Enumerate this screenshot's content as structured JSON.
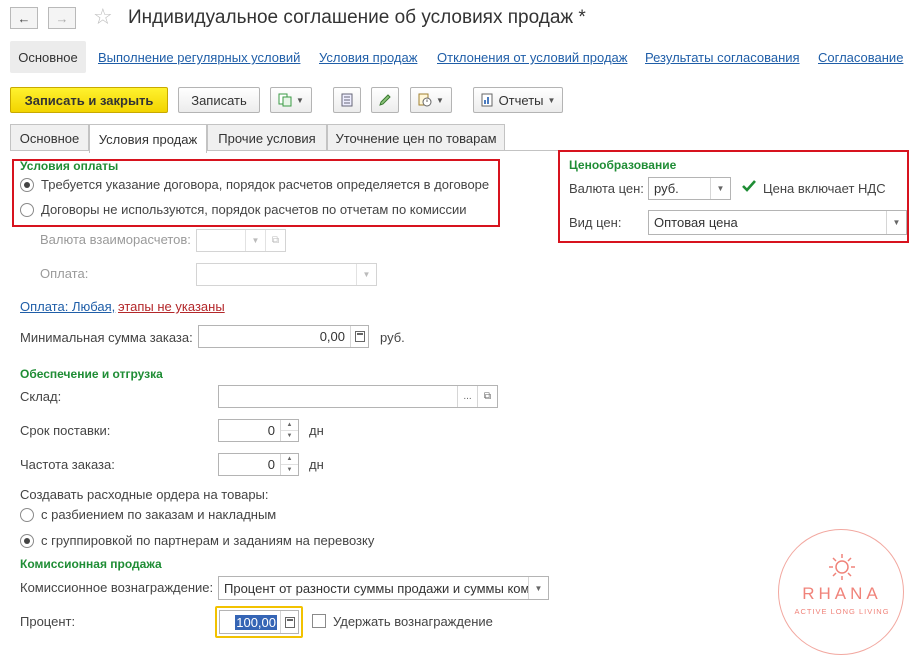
{
  "window": {
    "title": "Индивидуальное соглашение об условиях продаж *"
  },
  "nav_links": [
    {
      "label": "Основное"
    },
    {
      "label": "Выполнение регулярных условий"
    },
    {
      "label": "Условия продаж"
    },
    {
      "label": "Отклонения от условий продаж"
    },
    {
      "label": "Результаты согласования"
    },
    {
      "label": "Согласование"
    }
  ],
  "toolbar": {
    "save_close": "Записать и закрыть",
    "save": "Записать",
    "reports": "Отчеты"
  },
  "tabs": [
    {
      "label": "Основное"
    },
    {
      "label": "Условия продаж"
    },
    {
      "label": "Прочие условия"
    },
    {
      "label": "Уточнение цен по товарам"
    }
  ],
  "payment": {
    "title": "Условия оплаты",
    "opt1": "Требуется указание договора, порядок расчетов определяется в договоре",
    "opt2": "Договоры не используются, порядок расчетов по отчетам по комиссии",
    "currency_label": "Валюта взаиморасчетов:",
    "pay_label": "Оплата:",
    "link_a": "Оплата: Любая,",
    "link_b": "этапы не указаны"
  },
  "pricing": {
    "title": "Ценообразование",
    "currency_label": "Валюта цен:",
    "currency_value": "руб.",
    "vat_label": "Цена включает НДС",
    "price_type_label": "Вид цен:",
    "price_type_value": "Оптовая цена",
    "colors": {
      "accent": "#1f8d35",
      "highlight": "#d7131e"
    }
  },
  "min_order": {
    "label": "Минимальная сумма заказа:",
    "value": "0,00",
    "unit": "руб."
  },
  "shipping": {
    "title": "Обеспечение и отгрузка",
    "warehouse_label": "Склад:",
    "warehouse_value": "",
    "lead_label": "Срок поставки:",
    "lead_value": "0",
    "lead_unit": "дн",
    "freq_label": "Частота заказа:",
    "freq_value": "0",
    "freq_unit": "дн",
    "orders_label": "Создавать расходные ордера на товары:",
    "orders_opt1": "с разбиением по заказам и накладным",
    "orders_opt2": "с группировкой по партнерам и заданиям на перевозку"
  },
  "commission": {
    "title": "Комиссионная продажа",
    "reward_label": "Комиссионное вознаграждение:",
    "reward_value": "Процент от разности суммы продажи и суммы ком",
    "percent_label": "Процент:",
    "percent_value": "100,00",
    "withhold_label": "Удержать вознаграждение"
  },
  "watermark": {
    "brand": "RHANA",
    "tagline": "ACTIVE LONG LIVING"
  }
}
